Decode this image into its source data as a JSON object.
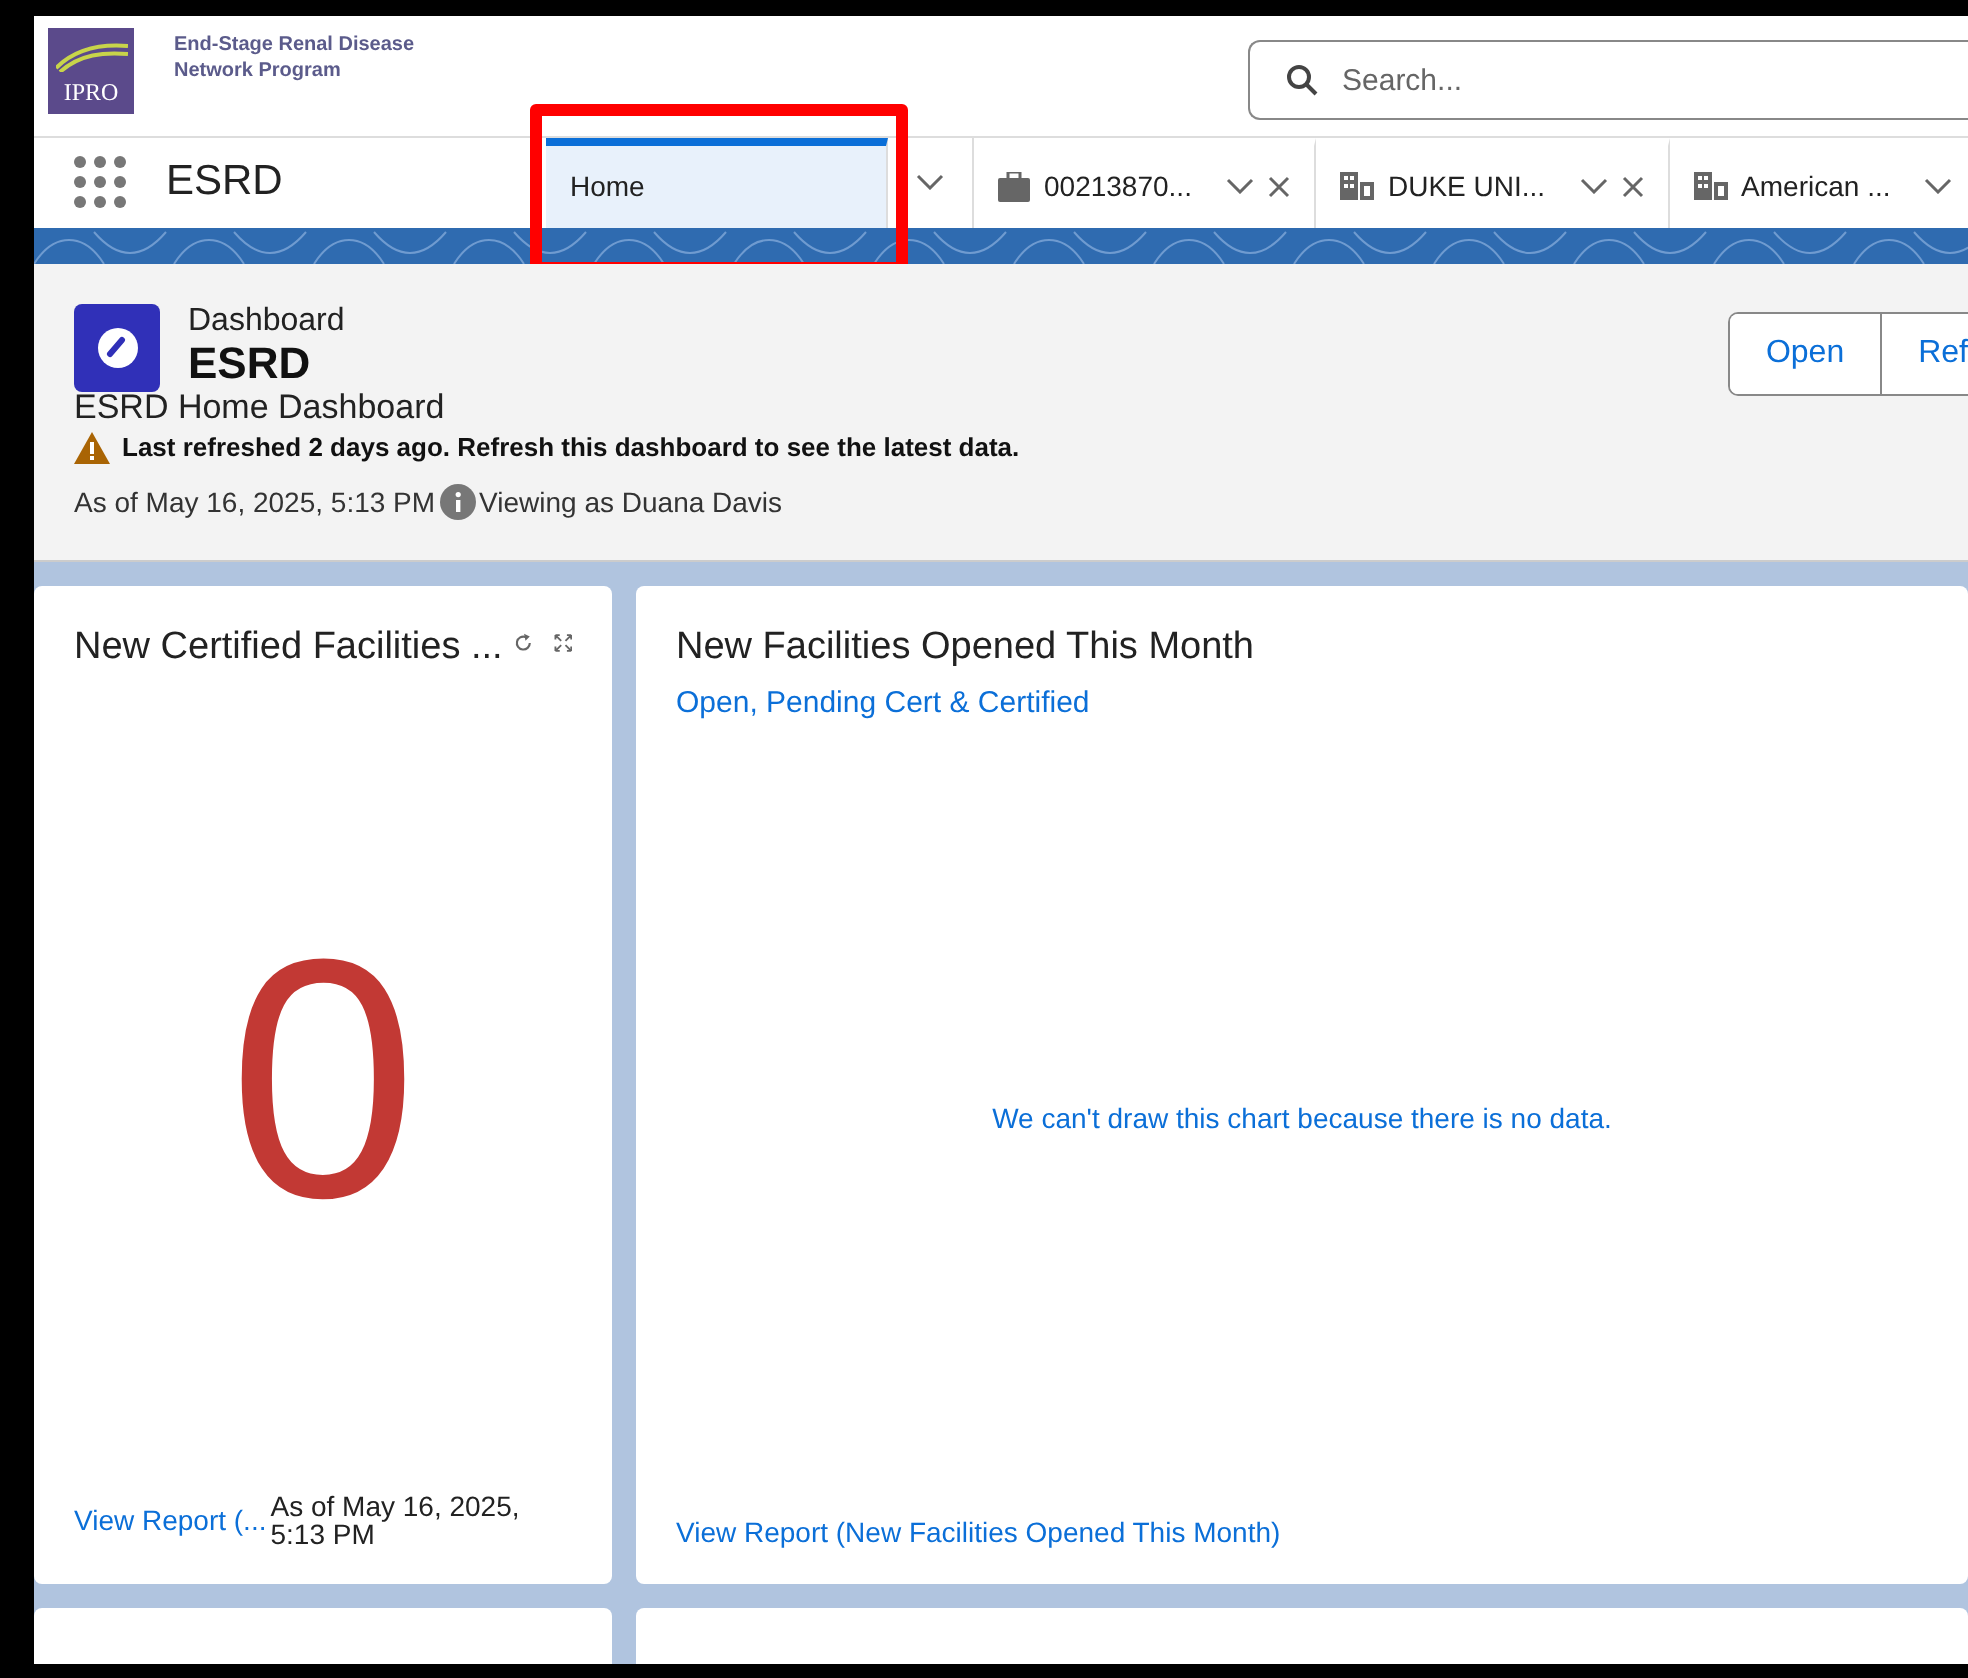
{
  "header": {
    "org_name": "End-Stage Renal Disease",
    "org_sub": "Network Program",
    "logo_text": "IPRO",
    "search": {
      "placeholder": "Search..."
    }
  },
  "nav": {
    "app_name": "ESRD",
    "tabs": [
      {
        "kind": "home",
        "label": "Home",
        "selected": true,
        "highlighted": true,
        "closable": false
      },
      {
        "kind": "case",
        "label": "00213870...",
        "selected": false,
        "highlighted": false,
        "closable": true
      },
      {
        "kind": "account",
        "label": "DUKE UNI...",
        "selected": false,
        "highlighted": false,
        "closable": true
      },
      {
        "kind": "account",
        "label": "American ...",
        "selected": false,
        "highlighted": false,
        "closable": false
      }
    ]
  },
  "dashboard": {
    "type_label": "Dashboard",
    "title": "ESRD",
    "description": "ESRD Home Dashboard",
    "warning": "Last refreshed 2 days ago. Refresh this dashboard to see the latest data.",
    "as_of": "As of May 16, 2025, 5:13 PM",
    "viewing_as": "Viewing as Duana Davis",
    "buttons": [
      "Open",
      "Ref"
    ]
  },
  "widgets": [
    {
      "kind": "metric",
      "title": "New Certified Facilities ...",
      "value": "0",
      "report_link": "View Report (...",
      "as_of": "As of May 16, 2025, 5:13 PM"
    },
    {
      "kind": "chart",
      "title": "New Facilities Opened This Month",
      "subtitle": "Open, Pending Cert & Certified",
      "message": "We can't draw this chart because there is no data.",
      "report_link": "View Report (New Facilities Opened This Month)"
    }
  ]
}
